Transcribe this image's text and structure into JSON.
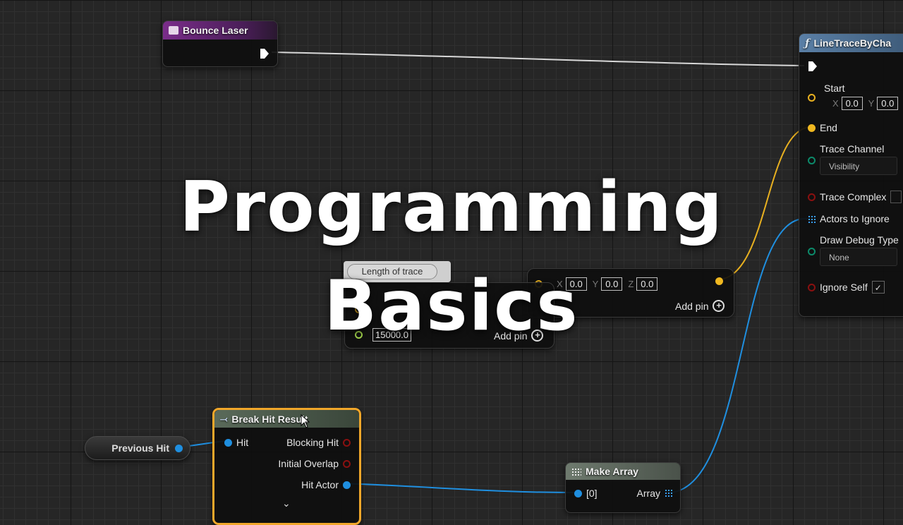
{
  "title_overlay": {
    "line1": "Programming",
    "line2": "Basics"
  },
  "bounce_laser": {
    "title": "Bounce Laser"
  },
  "line_trace": {
    "title": "LineTraceByCha",
    "start_label": "Start",
    "start_x_label": "X",
    "start_x": "0.0",
    "start_y_label": "Y",
    "start_y": "0.0",
    "end_label": "End",
    "trace_channel_label": "Trace Channel",
    "trace_channel_value": "Visibility",
    "trace_complex_label": "Trace Complex",
    "actors_to_ignore_label": "Actors to Ignore",
    "draw_debug_label": "Draw Debug Type",
    "draw_debug_value": "None",
    "ignore_self_label": "Ignore Self"
  },
  "vector_node": {
    "x_label": "X",
    "x": "0.0",
    "y_label": "Y",
    "y": "0.0",
    "z_label": "Z",
    "z": "0.0",
    "add_pin": "Add pin"
  },
  "length_node": {
    "comment": "Length of trace",
    "value": "15000.0",
    "add_pin": "Add pin"
  },
  "break_hit": {
    "title": "Break Hit Result",
    "hit": "Hit",
    "blocking_hit": "Blocking Hit",
    "initial_overlap": "Initial Overlap",
    "hit_actor": "Hit Actor"
  },
  "previous_hit": {
    "label": "Previous Hit"
  },
  "make_array": {
    "title": "Make Array",
    "index_label": "[0]",
    "array_label": "Array"
  },
  "colors": {
    "exec_wire": "#e6e6e6",
    "vector_wire": "#f0b820",
    "struct_wire": "#1f8fe0",
    "bool_pin": "#8a1010",
    "channel_pin": "#0c8a6a",
    "float_pin": "#9fd04a",
    "purple_header": "#6a2a7a",
    "function_header": "#4d6e8e",
    "pure_header": "#4e5e4e",
    "selection": "#f1a72a"
  },
  "icons": [
    "event-icon",
    "function-icon",
    "break-struct-icon",
    "make-array-icon",
    "checkbox-check-icon",
    "chevron-down-icon",
    "mouse-cursor-icon",
    "add-pin-icon"
  ]
}
